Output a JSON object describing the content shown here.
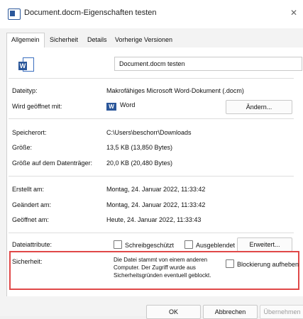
{
  "window": {
    "title": "Document.docm-Eigenschaften testen",
    "close_glyph": "✕"
  },
  "tabs": [
    {
      "label": "Allgemein",
      "active": true
    },
    {
      "label": "Sicherheit",
      "active": false
    },
    {
      "label": "Details",
      "active": false
    },
    {
      "label": "Vorherige Versionen",
      "active": false
    }
  ],
  "file_name": "Document.docm testen",
  "rows": {
    "dateityp": {
      "label": "Dateityp:",
      "value": "Makrofähiges Microsoft Word-Dokument (.docm)"
    },
    "geoeffnet_mit": {
      "label": "Wird geöffnet mit:",
      "value": "Word",
      "button": "Ändern..."
    },
    "speicherort": {
      "label": "Speicherort:",
      "value": "C:\\Users\\beschorr\\Downloads"
    },
    "groesse": {
      "label": "Größe:",
      "value": "13,5 KB (13,850 Bytes)"
    },
    "groesse_datentraeger": {
      "label": "Größe auf dem Datenträger:",
      "value": "20,0 KB (20,480 Bytes)"
    },
    "erstellt": {
      "label": "Erstellt am:",
      "value": "Montag, 24. Januar 2022, 11:33:42"
    },
    "geaendert": {
      "label": "Geändert am:",
      "value": "Montag, 24. Januar 2022, 11:33:42"
    },
    "geoeffnet": {
      "label": "Geöffnet am:",
      "value": "Heute, 24. Januar 2022, 11:33:43"
    }
  },
  "attributes": {
    "label": "Dateiattribute:",
    "schreibgeschuetzt": {
      "label": "Schreibgeschützt",
      "checked": false
    },
    "ausgeblendet": {
      "label": "Ausgeblendet",
      "checked": false
    },
    "erweitert_button": "Erweitert..."
  },
  "security": {
    "label": "Sicherheit:",
    "lines": [
      "Die Datei stammt von einem anderen",
      "Computer. Der Zugriff wurde aus",
      "Sicherheitsgründen eventuell geblockt."
    ],
    "unblock": {
      "label": "Blockierung aufheben",
      "checked": false
    },
    "highlight_color": "#e04848"
  },
  "buttons": {
    "ok": "OK",
    "cancel": "Abbrechen",
    "apply": "Übernehmen"
  },
  "icons": {
    "file": "word-document-icon",
    "word": "word-app-icon"
  }
}
